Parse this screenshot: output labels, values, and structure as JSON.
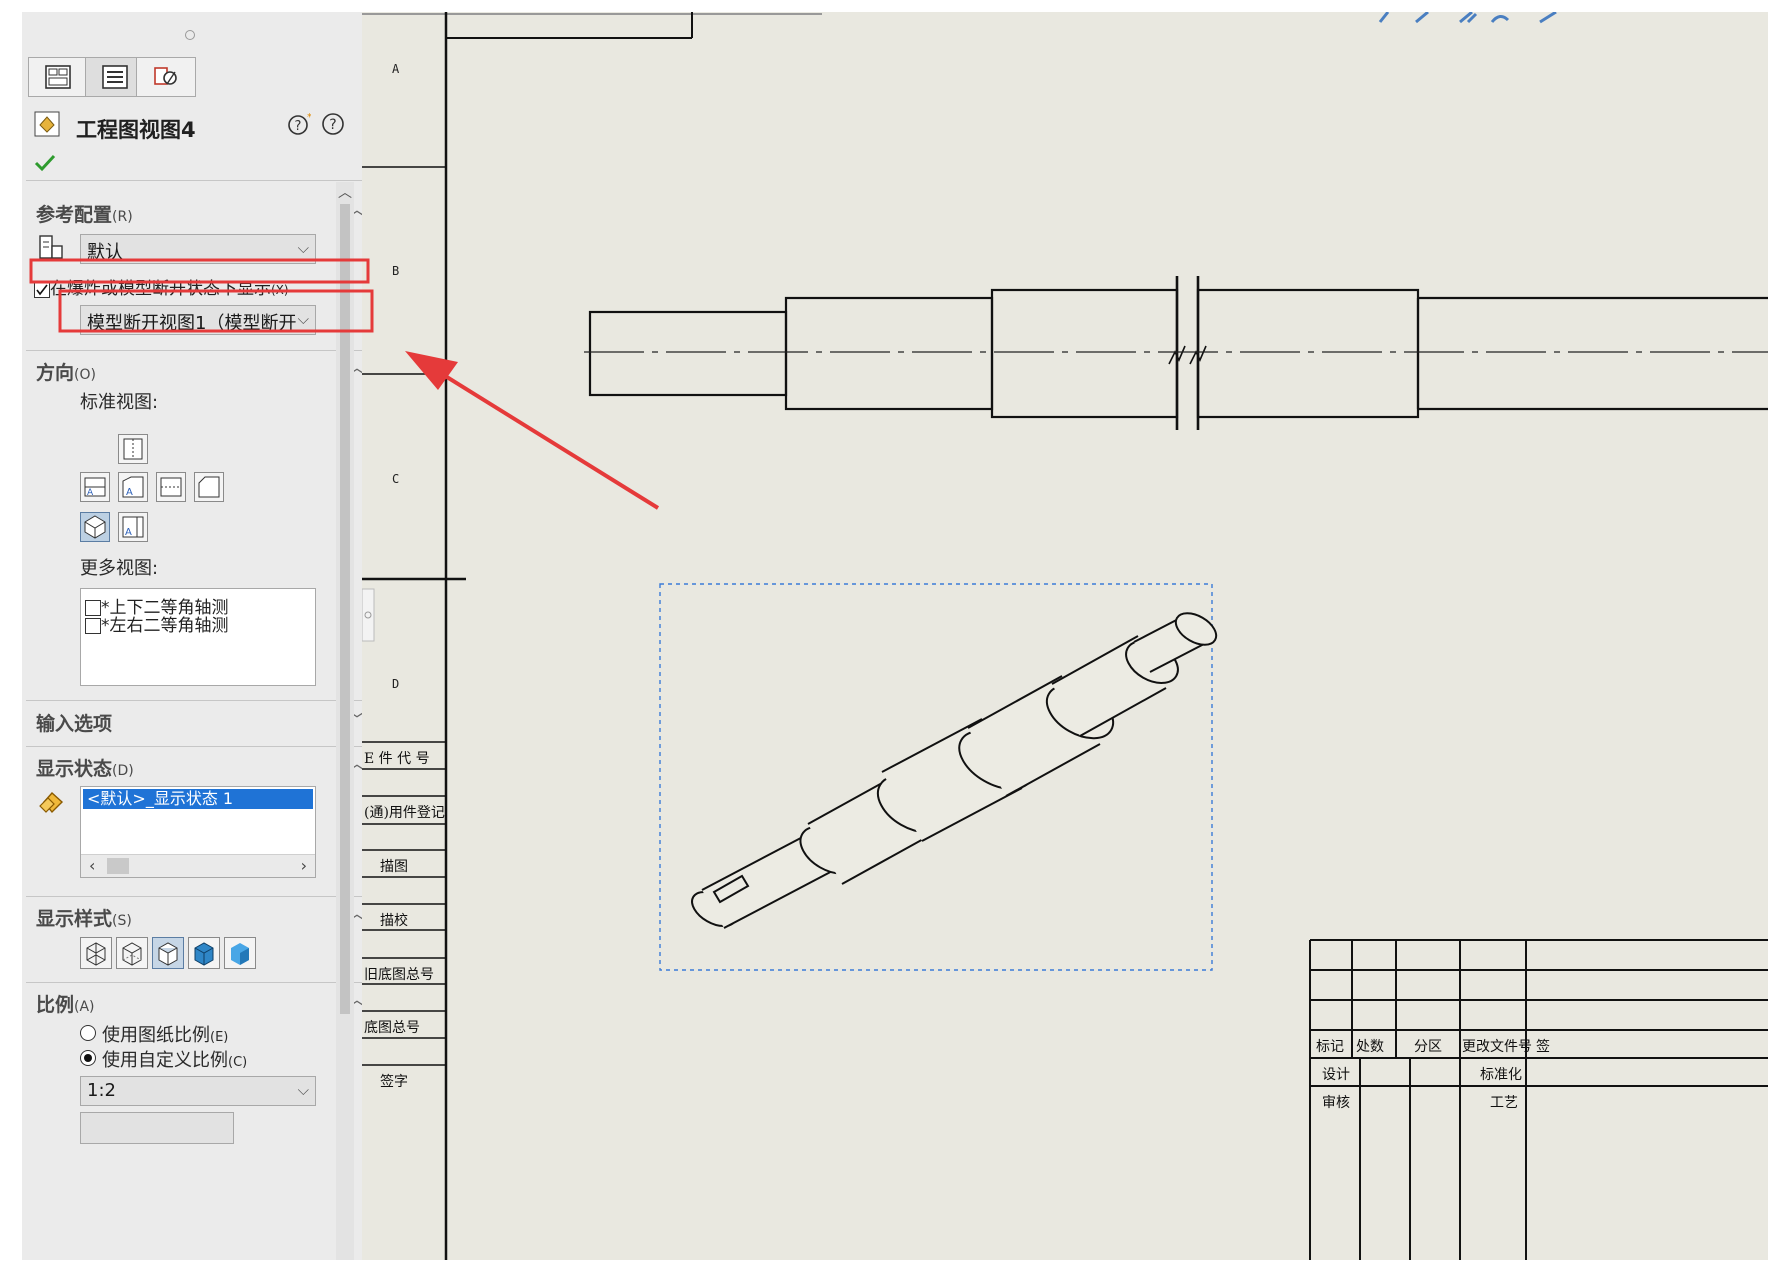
{
  "panel": {
    "title": "工程图视图4",
    "tabs": [
      "feature-manager",
      "property-manager",
      "configuration-manager"
    ],
    "reference_config": {
      "header": "参考配置",
      "shortcut": "(R)",
      "selected": "默认",
      "show_in_exploded_label": "在爆炸或模型断开状态下显示",
      "show_in_exploded_shortcut": "(X)",
      "show_in_exploded_checked": true,
      "break_view_selected": "模型断开视图1（模型断开"
    },
    "orientation": {
      "header": "方向",
      "shortcut": "(O)",
      "standard_views_label": "标准视图:",
      "more_views_label": "更多视图:",
      "more_views": [
        "*上下二等角轴测",
        "*左右二等角轴测"
      ]
    },
    "import_options": {
      "header": "输入选项"
    },
    "display_state": {
      "header": "显示状态",
      "shortcut": "(D)",
      "items": [
        "<默认>_显示状态 1"
      ]
    },
    "display_style": {
      "header": "显示样式",
      "shortcut": "(S)"
    },
    "scale": {
      "header": "比例",
      "shortcut": "(A)",
      "option_sheet": "使用图纸比例",
      "option_sheet_shortcut": "(E)",
      "option_custom": "使用自定义比例",
      "option_custom_shortcut": "(C)",
      "selected_option": "custom",
      "value": "1:2"
    }
  },
  "drawing": {
    "zones": [
      "A",
      "B",
      "C",
      "D"
    ],
    "left_title_cells": [
      "E 件 代 号",
      "(通)用件登记",
      "描图",
      "描校",
      "旧底图总号",
      "底图总号",
      "签字"
    ],
    "title_block": {
      "row_labels": [
        "标记",
        "处数",
        "分区",
        "更改文件号",
        "签"
      ],
      "design": "设计",
      "standardization": "标准化",
      "check": "审核",
      "process": "工艺"
    }
  },
  "annotations": {
    "highlight_color": "#e53a3a"
  }
}
